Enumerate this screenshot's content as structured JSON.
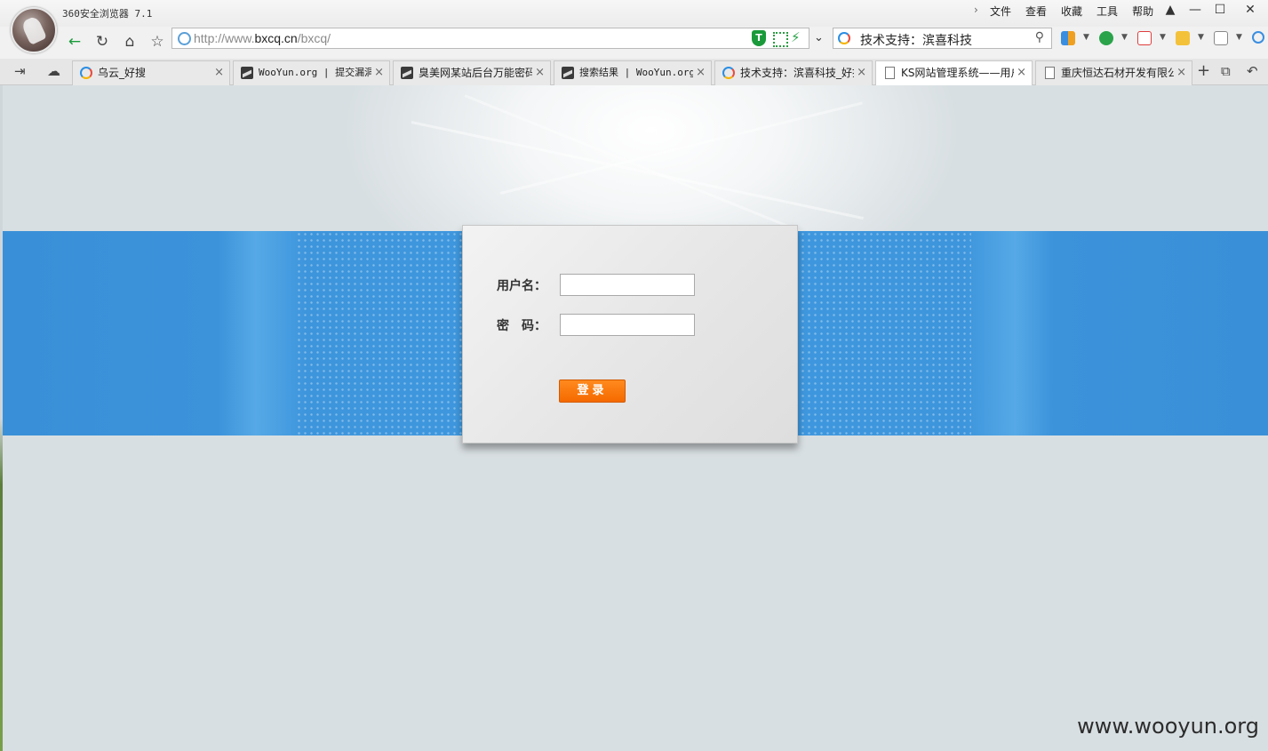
{
  "browser": {
    "title": "360安全浏览器 7.1",
    "menu": [
      "文件",
      "查看",
      "收藏",
      "工具",
      "帮助"
    ],
    "window_buttons": [
      "▲",
      "—",
      "☐",
      "✕"
    ],
    "url_prefix": "http://www.",
    "url_domain": "bxcq.cn",
    "url_path": "/bxcq/",
    "search_text": "技术支持：滨喜科技",
    "tabs": [
      {
        "label": "乌云_好搜",
        "icon": "search-logo-icon"
      },
      {
        "label": "WooYun.org | 提交漏洞",
        "icon": "wooyun-icon"
      },
      {
        "label": "臭美网某站后台万能密码",
        "icon": "wooyun-icon"
      },
      {
        "label": "搜索结果 | WooYun.org",
        "icon": "wooyun-icon"
      },
      {
        "label": "技术支持：滨喜科技_好搜",
        "icon": "search-logo-icon"
      },
      {
        "label": "KS网站管理系统——用户登录",
        "icon": "page-icon",
        "active": true
      },
      {
        "label": "重庆恒达石材开发有限公司",
        "icon": "page-icon"
      }
    ]
  },
  "login": {
    "username_label": "用户名：",
    "password_label": "密　码：",
    "username_value": "",
    "password_value": "",
    "submit_label": "登录"
  },
  "watermark": "www.wooyun.org"
}
